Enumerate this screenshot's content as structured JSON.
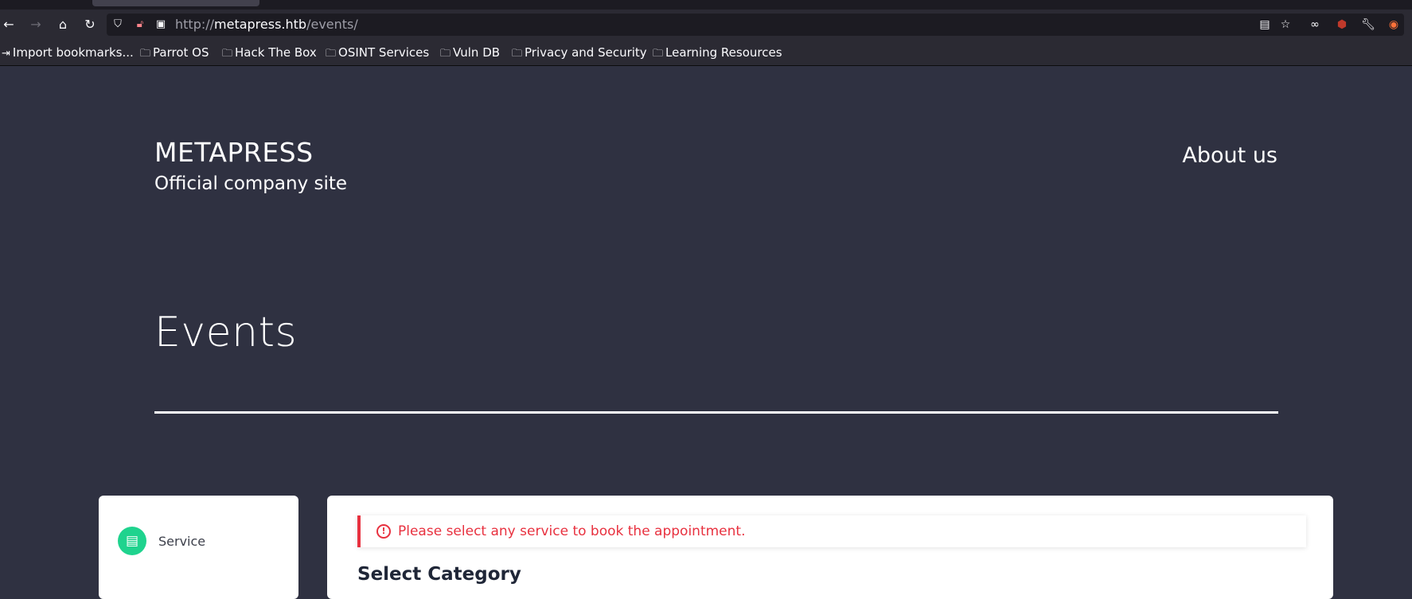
{
  "browser": {
    "url_scheme": "http://",
    "url_host": "metapress.htb",
    "url_path": "/events/",
    "bookmarks": [
      "Import bookmarks...",
      "Parrot OS",
      "Hack The Box",
      "OSINT Services",
      "Vuln DB",
      "Privacy and Security",
      "Learning Resources"
    ]
  },
  "site": {
    "brand": "METAPRESS",
    "tagline": "Official company site",
    "nav_about": "About us"
  },
  "page": {
    "title": "Events"
  },
  "booking": {
    "step_label": "Service",
    "alert_text": "Please select any service to book the appointment.",
    "section_title": "Select Category",
    "accent_color": "#1fd38e",
    "error_color": "#e8313f"
  }
}
